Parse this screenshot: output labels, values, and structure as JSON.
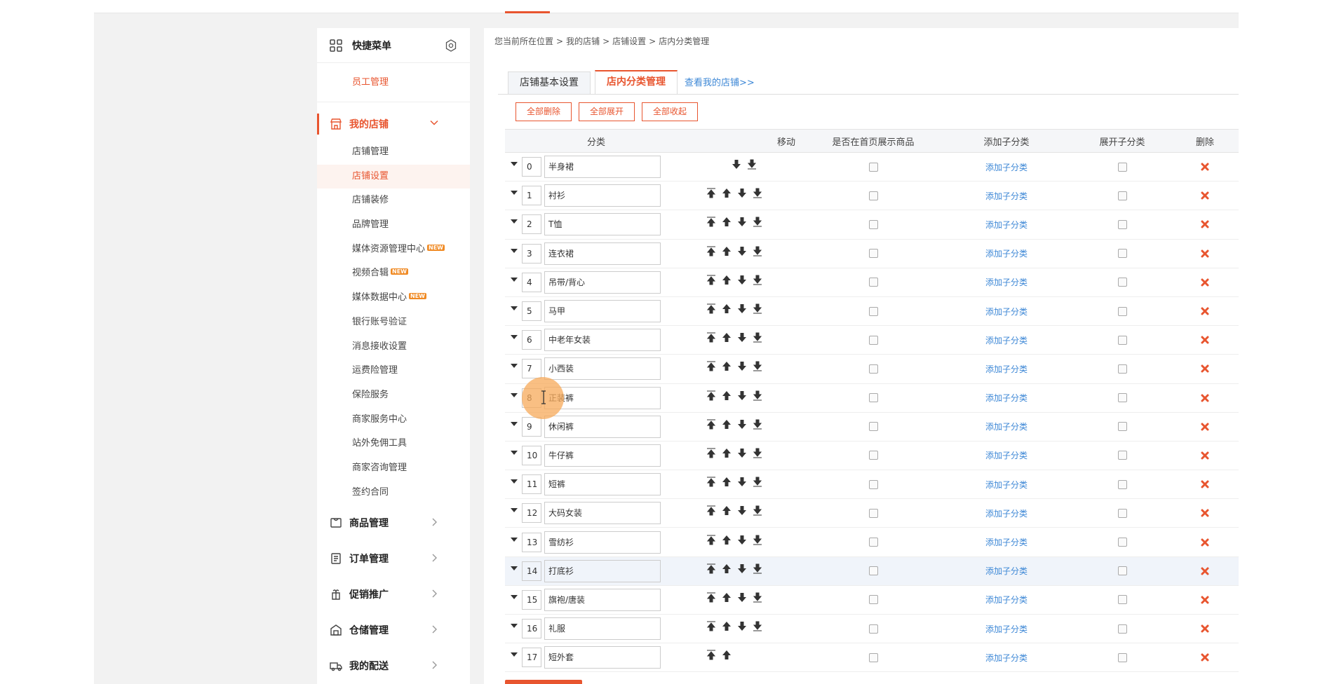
{
  "sidebar": {
    "quick_title": "快捷菜单",
    "staff": "员工管理",
    "store_section": "我的店铺",
    "store_items": [
      {
        "label": "店铺管理"
      },
      {
        "label": "店铺设置"
      },
      {
        "label": "店铺装修"
      },
      {
        "label": "品牌管理"
      },
      {
        "label": "媒体资源管理中心",
        "badge": "NEW"
      },
      {
        "label": "视频合辑",
        "badge": "NEW"
      },
      {
        "label": "媒体数据中心",
        "badge": "NEW"
      },
      {
        "label": "银行账号验证"
      },
      {
        "label": "消息接收设置"
      },
      {
        "label": "运费险管理"
      },
      {
        "label": "保险服务"
      },
      {
        "label": "商家服务中心"
      },
      {
        "label": "站外免佣工具"
      },
      {
        "label": "商家咨询管理"
      },
      {
        "label": "签约合同"
      }
    ],
    "groups": [
      {
        "label": "商品管理",
        "icon": "goods-icon"
      },
      {
        "label": "订单管理",
        "icon": "order-icon"
      },
      {
        "label": "促销推广",
        "icon": "promo-icon"
      },
      {
        "label": "仓储管理",
        "icon": "warehouse-icon"
      },
      {
        "label": "我的配送",
        "icon": "delivery-icon"
      }
    ]
  },
  "breadcrumb": [
    "您当前所在位置",
    ">",
    "我的店铺",
    ">",
    "店铺设置",
    ">",
    "店内分类管理"
  ],
  "tabs": [
    "店铺基本设置",
    "店内分类管理"
  ],
  "tab_link": "查看我的店铺>>",
  "actions": [
    "全部删除",
    "全部展开",
    "全部收起"
  ],
  "table": {
    "headers": {
      "category": "分类",
      "move": "移动",
      "show": "是否在首页展示商品",
      "add": "添加子分类",
      "expand": "展开子分类",
      "delete": "删除"
    },
    "add_label": "添加子分类",
    "rows": [
      {
        "order": "0",
        "name": "半身裙"
      },
      {
        "order": "1",
        "name": "衬衫"
      },
      {
        "order": "2",
        "name": "T恤"
      },
      {
        "order": "3",
        "name": "连衣裙"
      },
      {
        "order": "4",
        "name": "吊带/背心"
      },
      {
        "order": "5",
        "name": "马甲"
      },
      {
        "order": "6",
        "name": "中老年女装"
      },
      {
        "order": "7",
        "name": "小西装"
      },
      {
        "order": "8",
        "name": "正装裤"
      },
      {
        "order": "9",
        "name": "休闲裤"
      },
      {
        "order": "10",
        "name": "牛仔裤"
      },
      {
        "order": "11",
        "name": "短裤"
      },
      {
        "order": "12",
        "name": "大码女装"
      },
      {
        "order": "13",
        "name": "雪纺衫"
      },
      {
        "order": "14",
        "name": "打底衫"
      },
      {
        "order": "15",
        "name": "旗袍/唐装"
      },
      {
        "order": "16",
        "name": "礼服"
      },
      {
        "order": "17",
        "name": "短外套"
      }
    ]
  },
  "colors": {
    "accent": "#e8552f",
    "link": "#3c87d6"
  }
}
